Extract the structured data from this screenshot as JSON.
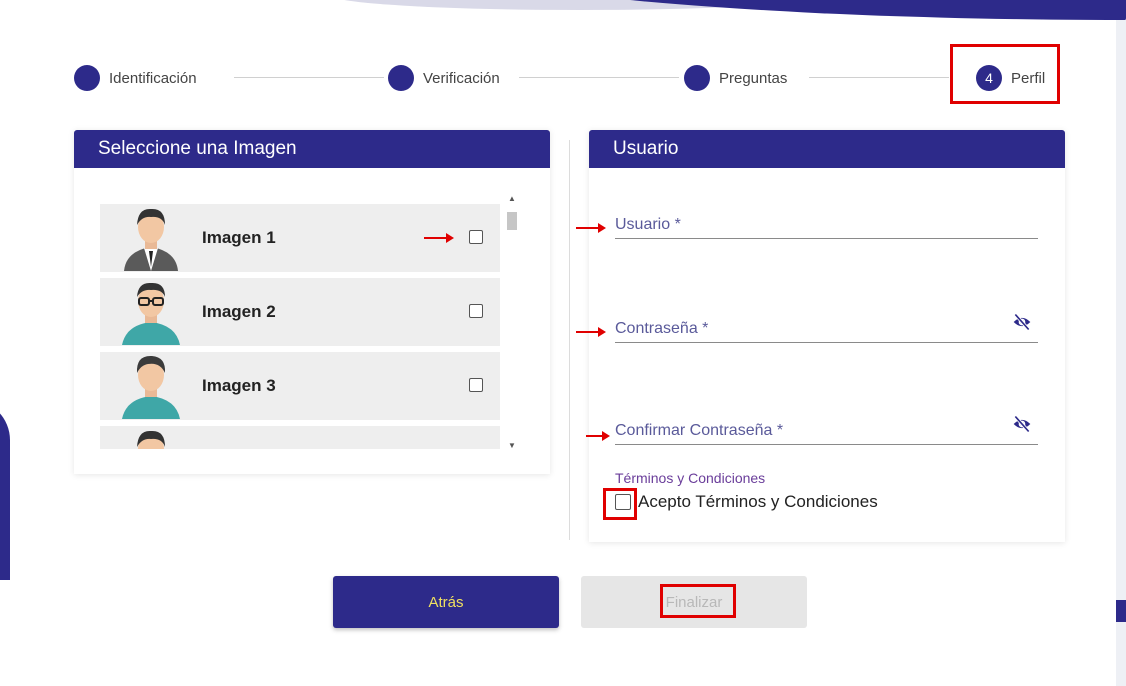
{
  "stepper": {
    "steps": [
      {
        "label": "Identificación",
        "number": ""
      },
      {
        "label": "Verificación",
        "number": ""
      },
      {
        "label": "Preguntas",
        "number": ""
      },
      {
        "label": "Perfil",
        "number": "4"
      }
    ]
  },
  "image_panel": {
    "title": "Seleccione una Imagen",
    "items": [
      {
        "label": "Imagen 1"
      },
      {
        "label": "Imagen 2"
      },
      {
        "label": "Imagen 3"
      },
      {
        "label": ""
      }
    ]
  },
  "user_panel": {
    "title": "Usuario",
    "fields": {
      "username_label": "Usuario *",
      "password_label": "Contraseña *",
      "confirm_label": "Confirmar Contraseña *"
    },
    "terms_title": "Términos y Condiciones",
    "terms_checkbox_label": "Acepto Términos y Condiciones"
  },
  "buttons": {
    "back_label": "Atrás",
    "finish_label": "Finalizar"
  },
  "colors": {
    "brand": "#2d2a8a",
    "annotation": "#e00000",
    "back_text": "#f0e060"
  },
  "icons": {
    "password_toggle": "eye-slash-icon",
    "avatar": "user-avatar-icon"
  }
}
